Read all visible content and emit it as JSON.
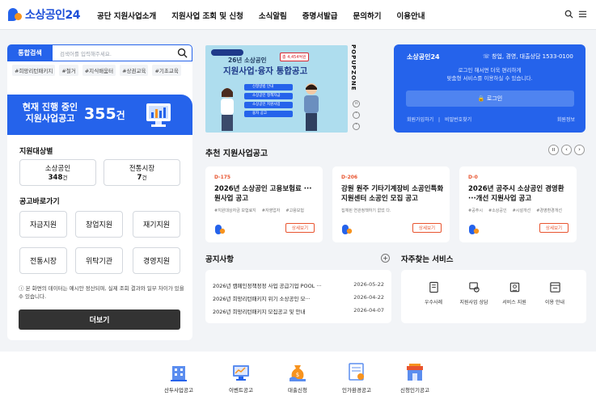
{
  "header": {
    "logo_text": "소상공인24",
    "nav": [
      "공단 지원사업소개",
      "지원사업 조회 및 신청",
      "소식알림",
      "증명서발급",
      "문의하기",
      "이용안내"
    ]
  },
  "search": {
    "tag": "통합검색",
    "placeholder": "검색어를 입력해주세요.",
    "keywords": [
      "#희망리턴패키지",
      "#철거",
      "#지식배움터",
      "#상권교육",
      "#기초교육"
    ]
  },
  "banner": {
    "line1": "현재 진행 중인",
    "line2": "지원사업공고",
    "count": "355",
    "suffix": "건"
  },
  "targets": {
    "title": "지원대상별",
    "items": [
      {
        "label": "소상공인",
        "value": "348",
        "unit": "건"
      },
      {
        "label": "전통시장",
        "value": "7",
        "unit": "건"
      }
    ]
  },
  "quick": {
    "title": "공고바로가기",
    "buttons": [
      "자금지원",
      "창업지원",
      "재기지원",
      "전통시장",
      "위탁기관",
      "경영지원"
    ]
  },
  "left_notice": "본 화면의 데이터는 예시안 정산되며, 실제 조회 결과와 일부 차이가 있을 수 있습니다.",
  "more_button": "더보기",
  "popup": {
    "year_label": "26년 소상공인",
    "title": "지원사업·융자 통합공고",
    "tag": "총 4,454억원",
    "steps": [
      "신청방법 안내",
      "소상공인 정책자금",
      "소상공인 지원사업",
      "융자 공고"
    ],
    "zone_label": "POPUPZONE"
  },
  "login": {
    "brand": "소상공인24",
    "phone": "창업, 경영, 대출상담 1533-0100",
    "message_1": "로그인 해서면 더욱 편리하게",
    "message_2": "맞춤형 서비스를 이용하실 수 있습니다.",
    "button": "로그인",
    "link_left": "회원가입하기",
    "link_mid": "비밀번호찾기",
    "link_right": "회원정보"
  },
  "recommend": {
    "title": "추천 지원사업공고",
    "cards": [
      {
        "dday": "D-175",
        "title": "2026년 소상공인 고용보험료 ··· 원사업 공고",
        "keywords": [
          "#지원대상자금 보험료지",
          "#자영업자",
          "#고용보험"
        ],
        "button": "상세보기"
      },
      {
        "dday": "D-206",
        "title": "강원 원주 기타기계장비 소공인특화지원센터 소공인 모집 공고",
        "keywords": [
          "집체된 연관정책하기 없었 다."
        ],
        "button": "상세보기"
      },
      {
        "dday": "D-0",
        "title": "2026년 공주시 소상공인 경영환···개선 지원사업 공고",
        "keywords": [
          "#공주시",
          "#소상공인",
          "#시설개선",
          "#경영환경개선"
        ],
        "button": "상세보기"
      }
    ]
  },
  "notices": {
    "title": "공지사항",
    "items": [
      {
        "text": "2026년 캠페인정책정정 사업 공급기업 POOL ···",
        "date": "2026-05-22"
      },
      {
        "text": "2026년 희망리턴패키지 위기 소상공인 모···",
        "date": "2026-04-22"
      },
      {
        "text": "2026년 희망리턴패키지 모집공고 및 안내",
        "date": "2026-04-07"
      }
    ]
  },
  "services": {
    "title": "자주찾는 서비스",
    "items": [
      "우수사례",
      "지원사업 상담",
      "서비스 지원",
      "이용 안내"
    ]
  },
  "footer": {
    "items": [
      "산두사업공고",
      "이벤트공고",
      "대출신청",
      "인가환경공고",
      "신청인기공고"
    ]
  },
  "colors": {
    "primary": "#2563eb",
    "accent": "#e8542f",
    "orange": "#f7931e"
  }
}
